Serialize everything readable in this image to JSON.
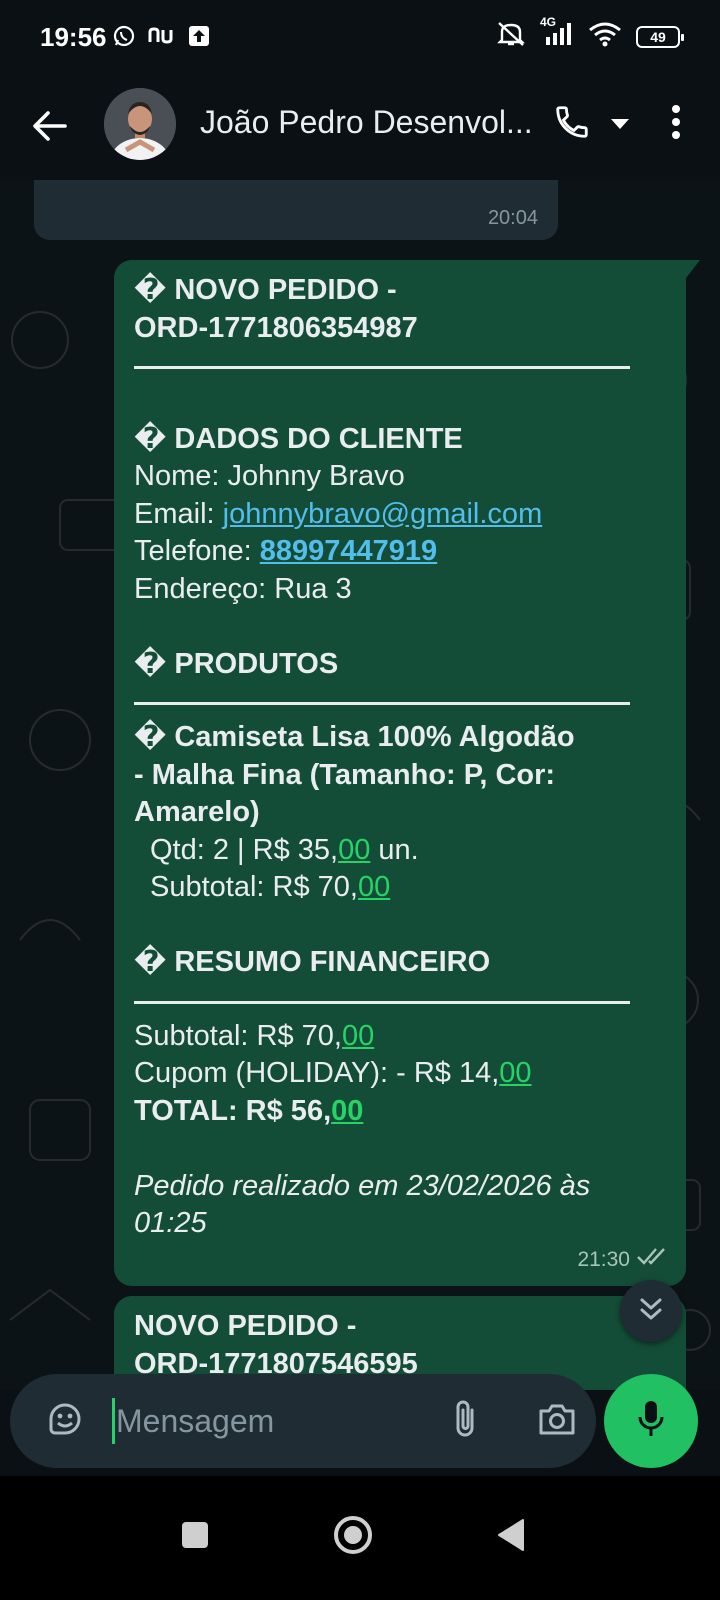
{
  "status_bar": {
    "time": "19:56",
    "network": "4G",
    "battery": "49"
  },
  "header": {
    "contact_name": "João Pedro Desenvol..."
  },
  "messages": {
    "incoming_time": "20:04",
    "order1": {
      "title_line1": "NOVO PEDIDO -",
      "title_line2": "ORD-1771806354987",
      "client_heading": "DADOS DO CLIENTE",
      "name_label": "Nome:",
      "name_value": "Johnny Bravo",
      "email_label": "Email:",
      "email_value": "johnnybravo@gmail.com",
      "phone_label": "Telefone:",
      "phone_value": "88997447919",
      "address_label": "Endereço:",
      "address_value": "Rua 3",
      "products_heading": "PRODUTOS",
      "product_line1": "Camiseta Lisa 100% Algodão",
      "product_line2": "- Malha Fina (Tamanho: P, Cor:",
      "product_line3": "Amarelo)",
      "qty_prefix": "Qtd: 2  |  R$ 35,",
      "qty_cents": "00",
      "qty_suffix": " un.",
      "item_subtotal_prefix": "Subtotal: R$ 70,",
      "item_subtotal_cents": "00",
      "summary_heading": "RESUMO FINANCEIRO",
      "subtotal_prefix": "Subtotal: R$ 70,",
      "subtotal_cents": "00",
      "coupon_prefix": "Cupom (HOLIDAY): - R$ 14,",
      "coupon_cents": "00",
      "total_prefix": "TOTAL: R$ 56,",
      "total_cents": "00",
      "footer_line1": "Pedido realizado em 23/02/2026 às",
      "footer_line2": "01:25",
      "time": "21:30",
      "glyph": "�"
    },
    "order2": {
      "title_line1": "NOVO PEDIDO -",
      "title_line2": "ORD-1771807546595"
    }
  },
  "composer": {
    "placeholder": "Mensagem"
  },
  "colors": {
    "outgoing_bubble": "#144d37",
    "incoming_bubble": "#202c33",
    "accent": "#21c063",
    "link": "#53bdeb"
  },
  "icons": {
    "back": "arrow-left-icon",
    "call": "phone-icon",
    "menu": "more-vertical-icon",
    "emoji": "sticker-icon",
    "attach": "paperclip-icon",
    "camera": "camera-icon",
    "mic": "mic-icon",
    "scroll": "double-chevron-down-icon"
  }
}
